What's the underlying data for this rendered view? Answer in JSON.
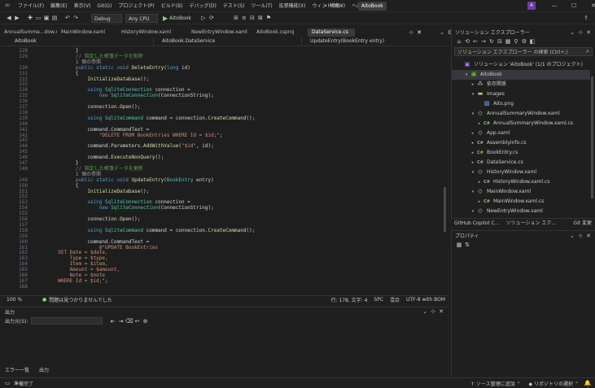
{
  "title_bar": {
    "menus": [
      "ファイル(F)",
      "編集(E)",
      "表示(V)",
      "Git(G)",
      "プロジェクト(P)",
      "ビルド(B)",
      "デバッグ(D)",
      "テスト(S)",
      "ツール(T)",
      "拡張機能(X)",
      "ウィンドウ(W)",
      "ヘルプ(H)"
    ],
    "search_label": "検索",
    "project_name": "AitoBook"
  },
  "toolbar": {
    "config": "Debug",
    "platform": "Any CPU",
    "run_target": "AitoBook"
  },
  "tabs": [
    {
      "label": "AnnualSumma...dow.xaml.cs",
      "active": false
    },
    {
      "label": "MainWindow.xaml",
      "active": false
    },
    {
      "label": "HistoryWindow.xaml",
      "active": false
    },
    {
      "label": "NewEntryWindow.xaml",
      "active": false
    },
    {
      "label": "AitoBook.csproj",
      "active": false
    },
    {
      "label": "DataService.cs",
      "active": true
    }
  ],
  "nav_bar": {
    "project": "AitoBook",
    "class": "AitoBook.DataService",
    "member": "UpdateEntry(BookEntry entry)"
  },
  "code": {
    "line_numbers": [
      "128",
      "129",
      "",
      "130",
      "131",
      "132",
      "133",
      "134",
      "135",
      "136",
      "137",
      "138",
      "139",
      "140",
      "141",
      "142",
      "143",
      "144",
      "145",
      "146",
      "147",
      "148",
      "",
      "149",
      "150",
      "151",
      "152",
      "153",
      "154",
      "155",
      "156",
      "157",
      "158",
      "159",
      "160",
      "161",
      "162",
      "163",
      "164",
      "165",
      "166",
      "167",
      "168"
    ],
    "lines": [
      [
        [
          "pl",
          "        }"
        ]
      ],
      [
        [
          "cm",
          "        // 指定した帳簿データを削除"
        ]
      ],
      [
        [
          "ref",
          "        1 個の参照"
        ]
      ],
      [
        [
          "kw",
          "        public static void "
        ],
        [
          "fn",
          "DeleteEntry"
        ],
        [
          "pl",
          "("
        ],
        [
          "kw",
          "long"
        ],
        [
          "pl",
          " id)"
        ]
      ],
      [
        [
          "pl",
          "        {"
        ]
      ],
      [
        [
          "pl",
          "            "
        ],
        [
          "fn",
          "InitializeDatabase"
        ],
        [
          "pl",
          "();"
        ]
      ],
      [
        [
          "pl",
          ""
        ]
      ],
      [
        [
          "kw",
          "            using "
        ],
        [
          "ty",
          "SqliteConnection"
        ],
        [
          "pl",
          " connection ="
        ]
      ],
      [
        [
          "kw",
          "                new "
        ],
        [
          "ty",
          "SqliteConnection"
        ],
        [
          "pl",
          "(ConnectionString);"
        ]
      ],
      [
        [
          "pl",
          ""
        ]
      ],
      [
        [
          "pl",
          "            connection."
        ],
        [
          "fn",
          "Open"
        ],
        [
          "pl",
          "();"
        ]
      ],
      [
        [
          "pl",
          ""
        ]
      ],
      [
        [
          "kw",
          "            using "
        ],
        [
          "ty",
          "SqliteCommand"
        ],
        [
          "pl",
          " command = connection."
        ],
        [
          "fn",
          "CreateCommand"
        ],
        [
          "pl",
          "();"
        ]
      ],
      [
        [
          "pl",
          ""
        ]
      ],
      [
        [
          "pl",
          "            command.CommandText ="
        ]
      ],
      [
        [
          "str",
          "                \"DELETE FROM BookEntries WHERE Id = $id;\""
        ],
        [
          "pl",
          ";"
        ]
      ],
      [
        [
          "pl",
          ""
        ]
      ],
      [
        [
          "pl",
          "            command.Parameters."
        ],
        [
          "fn",
          "AddWithValue"
        ],
        [
          "pl",
          "("
        ],
        [
          "str",
          "\"$id\""
        ],
        [
          "pl",
          ", id);"
        ]
      ],
      [
        [
          "pl",
          ""
        ]
      ],
      [
        [
          "pl",
          "            command."
        ],
        [
          "fn",
          "ExecuteNonQuery"
        ],
        [
          "pl",
          "();"
        ]
      ],
      [
        [
          "pl",
          "        }"
        ]
      ],
      [
        [
          "cm",
          "        // 指定した帳簿データを更新"
        ]
      ],
      [
        [
          "ref",
          "        1 個の参照"
        ]
      ],
      [
        [
          "kw",
          "        public static void "
        ],
        [
          "fn",
          "UpdateEntry"
        ],
        [
          "pl",
          "("
        ],
        [
          "ty",
          "BookEntry"
        ],
        [
          "pl",
          " entry)"
        ]
      ],
      [
        [
          "pl",
          "        {"
        ]
      ],
      [
        [
          "pl",
          "            "
        ],
        [
          "fn",
          "InitializeDatabase"
        ],
        [
          "pl",
          "();"
        ]
      ],
      [
        [
          "pl",
          ""
        ]
      ],
      [
        [
          "kw",
          "            using "
        ],
        [
          "ty",
          "SqliteConnection"
        ],
        [
          "pl",
          " connection ="
        ]
      ],
      [
        [
          "kw",
          "                new "
        ],
        [
          "ty",
          "SqliteConnection"
        ],
        [
          "pl",
          "(ConnectionString);"
        ]
      ],
      [
        [
          "pl",
          ""
        ]
      ],
      [
        [
          "pl",
          "            connection."
        ],
        [
          "fn",
          "Open"
        ],
        [
          "pl",
          "();"
        ]
      ],
      [
        [
          "pl",
          ""
        ]
      ],
      [
        [
          "kw",
          "            using "
        ],
        [
          "ty",
          "SqliteCommand"
        ],
        [
          "pl",
          " command = connection."
        ],
        [
          "fn",
          "CreateCommand"
        ],
        [
          "pl",
          "();"
        ]
      ],
      [
        [
          "pl",
          ""
        ]
      ],
      [
        [
          "pl",
          "            command.CommandText ="
        ]
      ],
      [
        [
          "str",
          "                @\"UPDATE BookEntries"
        ]
      ],
      [
        [
          "str",
          "  SET Date = $date,"
        ]
      ],
      [
        [
          "str",
          "      Type = $type,"
        ]
      ],
      [
        [
          "str",
          "      Item = $item,"
        ]
      ],
      [
        [
          "str",
          "      Amount = $amount,"
        ]
      ],
      [
        [
          "str",
          "      Note = $note"
        ]
      ],
      [
        [
          "str",
          "  WHERE Id = $id;\""
        ],
        [
          "pl",
          ";"
        ]
      ],
      [
        [
          "pl",
          ""
        ]
      ]
    ]
  },
  "editor_status": {
    "zoom": "100 %",
    "issues": "問題は見つかりませんでした",
    "position": "行: 178, 文字: 4",
    "spc": "SPC",
    "mixed": "混合",
    "encoding": "UTF-8 with BOM"
  },
  "output_panel": {
    "title": "出力",
    "source_label": "出力元(S):"
  },
  "bottom_tabs": [
    "エラー一覧",
    "出力"
  ],
  "status_bar": {
    "ready": "準備完了",
    "source_control": "ソース管理に追加",
    "repository": "リポジトリの選択"
  },
  "solution_explorer": {
    "title": "ソリューション エクスプローラー",
    "search_placeholder": "ソリューション エクスプローラー の検索 (Ctrl+;)",
    "items": [
      {
        "label": "ソリューション 'AitoBook' (1/1 のプロジェクト)",
        "indent": 0,
        "icon": "solution-icon",
        "arrow": "",
        "selected": false
      },
      {
        "label": "AitoBook",
        "indent": 1,
        "icon": "csharp-project-icon",
        "arrow": "▾",
        "selected": true
      },
      {
        "label": "依存関係",
        "indent": 2,
        "icon": "dependencies-icon",
        "arrow": "▸",
        "selected": false
      },
      {
        "label": "Images",
        "indent": 2,
        "icon": "folder-icon",
        "arrow": "▾",
        "selected": false
      },
      {
        "label": "Aito.png",
        "indent": 3,
        "icon": "image-file-icon",
        "arrow": "",
        "selected": false
      },
      {
        "label": "AnnualSummaryWindow.xaml",
        "indent": 2,
        "icon": "xaml-file-icon",
        "arrow": "▾",
        "selected": false
      },
      {
        "label": "AnnualSummaryWindow.xaml.cs",
        "indent": 3,
        "icon": "csharp-file-icon",
        "arrow": "▸",
        "selected": false
      },
      {
        "label": "App.xaml",
        "indent": 2,
        "icon": "xaml-file-icon",
        "arrow": "▸",
        "selected": false
      },
      {
        "label": "AssemblyInfo.cs",
        "indent": 2,
        "icon": "csharp-file-icon",
        "arrow": "▸",
        "selected": false
      },
      {
        "label": "BookEntry.cs",
        "indent": 2,
        "icon": "csharp-file-icon",
        "arrow": "▸",
        "selected": false
      },
      {
        "label": "DataService.cs",
        "indent": 2,
        "icon": "csharp-file-icon",
        "arrow": "▸",
        "selected": false
      },
      {
        "label": "HistoryWindow.xaml",
        "indent": 2,
        "icon": "xaml-file-icon",
        "arrow": "▾",
        "selected": false
      },
      {
        "label": "HistoryWindow.xaml.cs",
        "indent": 3,
        "icon": "csharp-file-icon",
        "arrow": "▸",
        "selected": false
      },
      {
        "label": "MainWindow.xaml",
        "indent": 2,
        "icon": "xaml-file-icon",
        "arrow": "▾",
        "selected": false
      },
      {
        "label": "MainWindow.xaml.cs",
        "indent": 3,
        "icon": "csharp-file-icon",
        "arrow": "▸",
        "selected": false
      },
      {
        "label": "NewEntryWindow.xaml",
        "indent": 2,
        "icon": "xaml-file-icon",
        "arrow": "▾",
        "selected": false
      }
    ]
  },
  "right_tabs": [
    "GitHub Copilot C...",
    "ソリューション エク...",
    "Git 変更"
  ],
  "properties": {
    "title": "プロパティ"
  },
  "colors": {
    "accent": "#0e639c",
    "keyword": "#569cd6",
    "type": "#4ec9b0",
    "string": "#ce9178",
    "comment": "#57a64a"
  }
}
